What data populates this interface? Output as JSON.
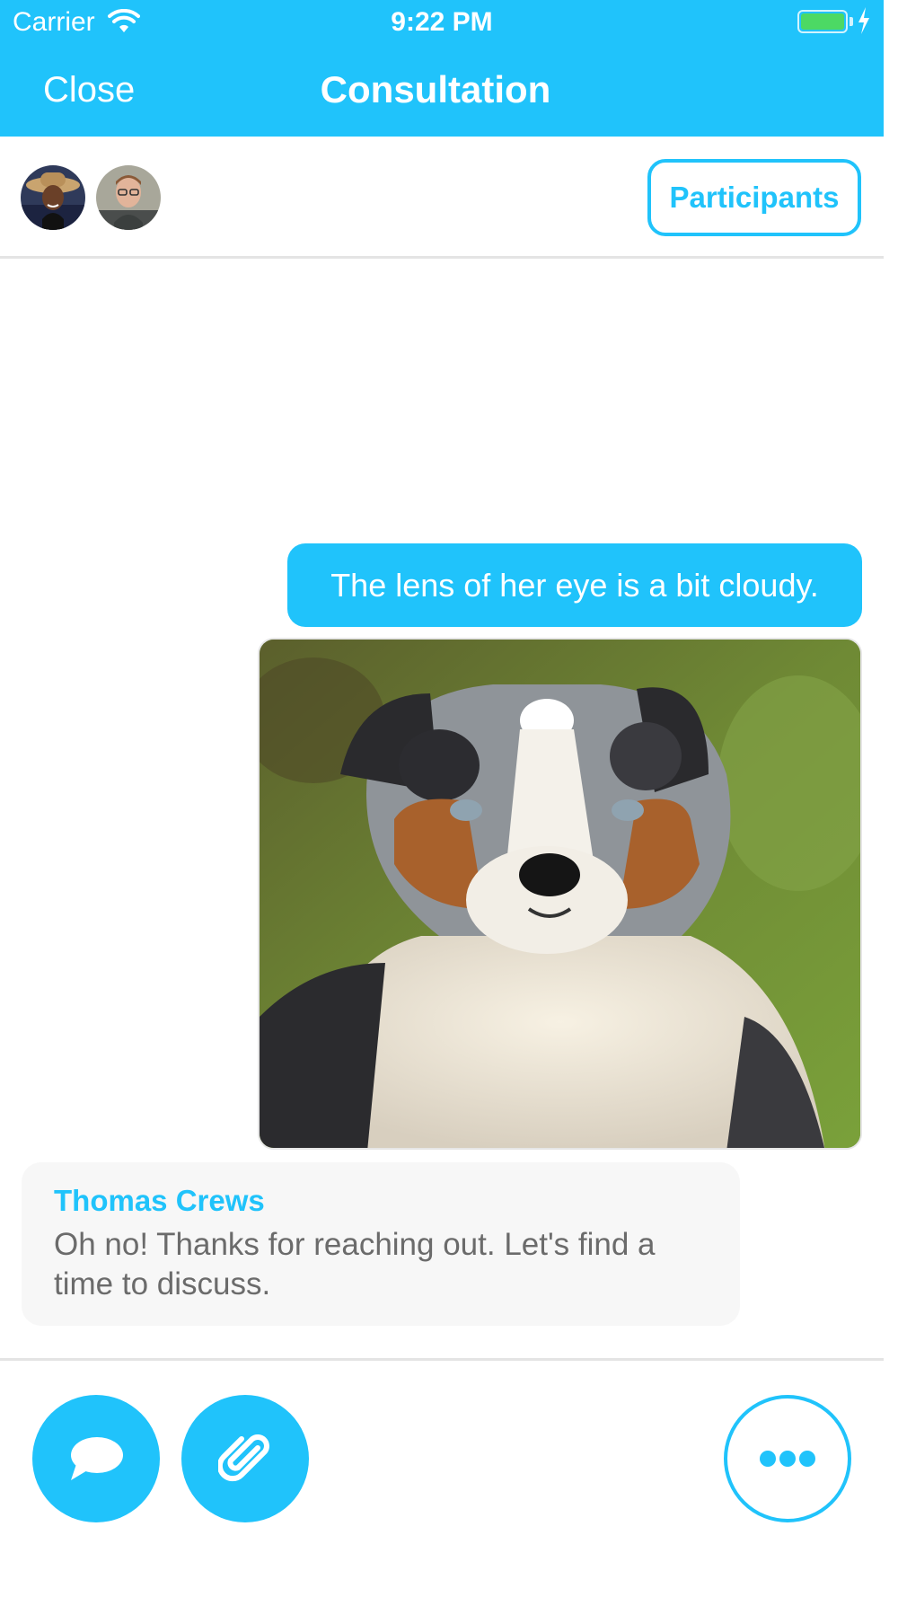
{
  "status_bar": {
    "carrier": "Carrier",
    "time": "9:22 PM",
    "icons": [
      "wifi-icon",
      "battery-icon",
      "charging-bolt-icon"
    ]
  },
  "nav": {
    "close_label": "Close",
    "title": "Consultation"
  },
  "participants_bar": {
    "avatars": [
      "woman-with-hat-avatar",
      "man-with-glasses-avatar"
    ],
    "button_label": "Participants"
  },
  "messages": [
    {
      "direction": "outgoing",
      "type": "text",
      "text": "The lens of her eye is a bit cloudy."
    },
    {
      "direction": "outgoing",
      "type": "image",
      "image_description": "dog-photo"
    },
    {
      "direction": "incoming",
      "type": "text",
      "sender": "Thomas Crews",
      "text": "Oh no! Thanks for reaching out. Let's find a time to discuss."
    }
  ],
  "toolbar": {
    "icons": [
      "chat-bubble-icon",
      "paperclip-icon",
      "more-dots-icon"
    ]
  },
  "colors": {
    "accent": "#20c3fb",
    "incoming_bubble": "#f7f7f7",
    "incoming_text": "#6b6b6b",
    "divider": "#e4e4e4"
  }
}
